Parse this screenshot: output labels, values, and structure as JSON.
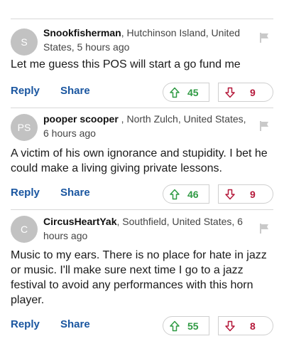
{
  "comments": [
    {
      "avatar": "S",
      "author": "Snookfisherman",
      "location": ", Hutchinson Island, United States, 5 hours ago",
      "text": "Let me guess this POS will start a go fund me",
      "reply_label": "Reply",
      "share_label": "Share",
      "upvotes": "45",
      "downvotes": "9"
    },
    {
      "avatar": "PS",
      "author": "pooper scooper",
      "location": " , North Zulch, United States, 6 hours ago",
      "text": "A victim of his own ignorance and stupidity. I bet he could make a living giving private lessons.",
      "reply_label": "Reply",
      "share_label": "Share",
      "upvotes": "46",
      "downvotes": "9"
    },
    {
      "avatar": "C",
      "author": "CircusHeartYak",
      "location": ", Southfield, United States, 6 hours ago",
      "text": "Music to my ears. There is no place for hate in jazz or music. I'll make sure next time I go to a jazz festival to avoid any performances with this horn player.",
      "reply_label": "Reply",
      "share_label": "Share",
      "upvotes": "55",
      "downvotes": "8"
    }
  ],
  "icons": {
    "flag": "flag-icon",
    "upvote": "arrow-up-icon",
    "downvote": "arrow-down-icon"
  },
  "colors": {
    "link": "#1a56a0",
    "upvote": "#2f9a43",
    "downvote": "#b5193a",
    "avatar_bg": "#c2c2c2",
    "divider": "#d8d8d8"
  }
}
